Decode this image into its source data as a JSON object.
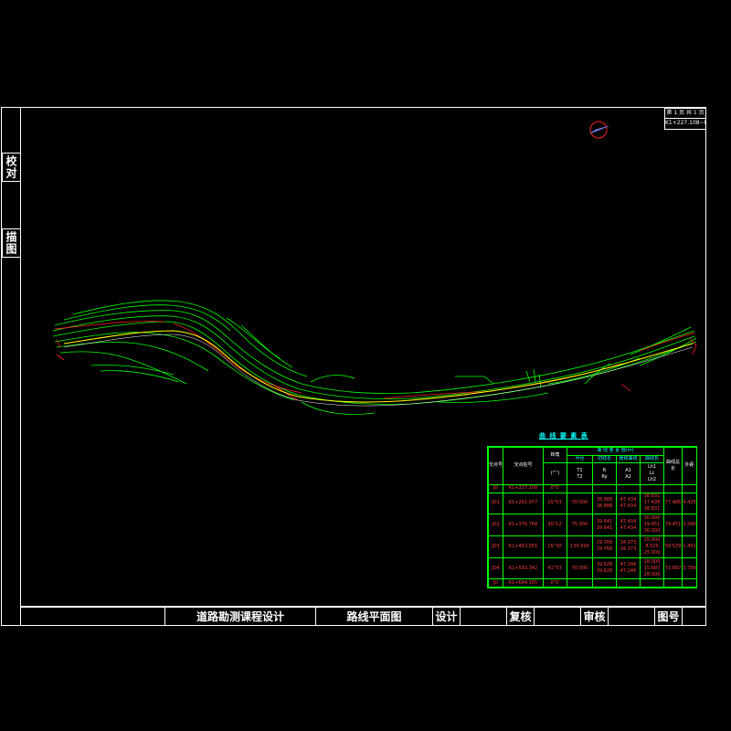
{
  "side_tabs": [
    {
      "label": "校对"
    },
    {
      "label": "描图"
    }
  ],
  "sheet": {
    "page_line": "第 1 页  共 1 页",
    "stake_range": "K1+227.108~K1+727.108"
  },
  "title_bar": {
    "project": "道路勘测课程设计",
    "drawing_name": "路线平面图",
    "design_label": "设计",
    "check_label": "复核",
    "review_label": "审核",
    "drawing_no_label": "图号"
  },
  "curve_table": {
    "title": "曲 线 要 素 表",
    "group_header": "曲 线 要 素 值(m)",
    "headers": {
      "jd": "交点号",
      "stake": "交点桩号",
      "angle": "转角",
      "angle_unit": "(°′″)",
      "sub_radius": "半径",
      "sub_tangent": "切线长",
      "sub_curve": "曲线长",
      "sub_spiral": "缓和曲线",
      "t": "T1",
      "t2": "T2",
      "r": "R",
      "ry": "Ry",
      "ls": "A1",
      "ls2": "A2",
      "lh": "Lh1",
      "lh2": "Lc",
      "lh3": "Lh2",
      "l": "曲线总长",
      "e": "外距"
    },
    "rows": [
      {
        "jd": "JD",
        "stake": "K1+227.108",
        "angle": "0°0′",
        "t": "",
        "r": "",
        "ls": "",
        "lh": "",
        "l": "",
        "e": ""
      },
      {
        "jd": "JD1",
        "stake": "K1+291.077",
        "angle": "15°53′",
        "t": "38.888\n38.888",
        "r": "70.000",
        "ls": "47.434\n47.434",
        "lh": "38.831\n17.426\n38.831",
        "l": "77.486",
        "e": "4.425"
      },
      {
        "jd": "JD2",
        "stake": "K1+376.768",
        "angle": "30°12′",
        "t": "39.641\n39.641",
        "r": "75.000",
        "ls": "47.434\n47.434",
        "lh": "30.000\n19.451\n30.000",
        "l": "79.451",
        "e": "3.590"
      },
      {
        "jd": "JD3",
        "stake": "K1+453.055",
        "angle": "15°30′",
        "t": "29.766\n29.766",
        "r": "135.000",
        "ls": "34.373\n34.373",
        "lh": "25.000\n8.529\n25.000",
        "l": "58.529",
        "e": "1.451"
      },
      {
        "jd": "JD4",
        "stake": "K1+593.342",
        "angle": "41°53′",
        "t": "39.626\n39.626",
        "r": "70.000",
        "ls": "47.246\n47.246",
        "lh": "28.000\n15.687\n28.000",
        "l": "72.687",
        "e": "3.799"
      },
      {
        "jd": "JD",
        "stake": "K1+694.165",
        "angle": "0°0′",
        "t": "",
        "r": "",
        "ls": "",
        "lh": "",
        "l": "",
        "e": ""
      }
    ]
  },
  "colors": {
    "frame": "#ffffff",
    "contour": "#00ff00",
    "centerline": "#ffff00",
    "boundary": "#ff2020",
    "table_text": "#ff4040",
    "table_title": "#00ffff"
  }
}
